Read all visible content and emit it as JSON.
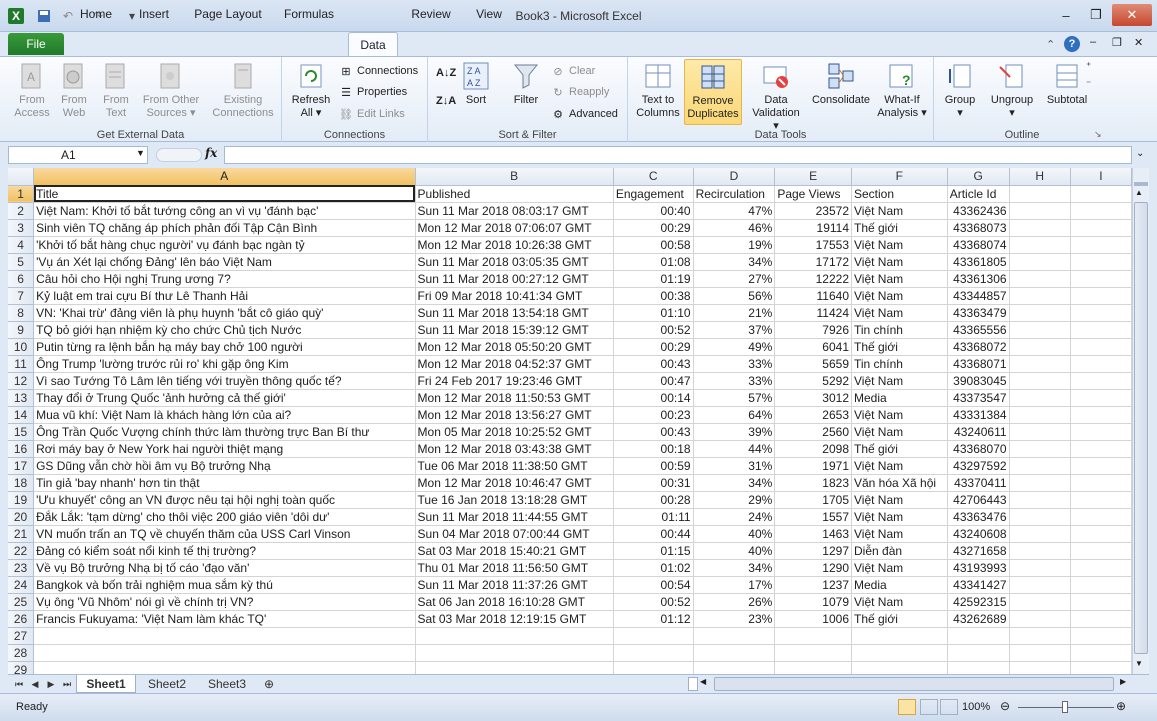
{
  "window": {
    "title": "Book3 - Microsoft Excel"
  },
  "tabs": [
    "File",
    "Home",
    "Insert",
    "Page Layout",
    "Formulas",
    "Data",
    "Review",
    "View"
  ],
  "ribbon": {
    "get_external": {
      "label": "Get External Data",
      "from_access": "From Access",
      "from_web": "From Web",
      "from_text": "From Text",
      "from_other": "From Other Sources",
      "existing": "Existing Connections"
    },
    "connections": {
      "label": "Connections",
      "refresh_all": "Refresh All",
      "connections": "Connections",
      "properties": "Properties",
      "edit_links": "Edit Links"
    },
    "sort_filter": {
      "label": "Sort & Filter",
      "sort": "Sort",
      "filter": "Filter",
      "clear": "Clear",
      "reapply": "Reapply",
      "advanced": "Advanced"
    },
    "data_tools": {
      "label": "Data Tools",
      "text_to_columns": "Text to Columns",
      "remove_duplicates": "Remove Duplicates",
      "data_validation": "Data Validation",
      "consolidate": "Consolidate",
      "what_if": "What-If Analysis"
    },
    "outline": {
      "label": "Outline",
      "group": "Group",
      "ungroup": "Ungroup",
      "subtotal": "Subtotal"
    }
  },
  "formula_bar": {
    "name_box": "A1",
    "fx": "fx",
    "formula": ""
  },
  "columns": [
    "A",
    "B",
    "C",
    "D",
    "E",
    "F",
    "G",
    "H",
    "I"
  ],
  "rows": [
    [
      "Title",
      "Published",
      "Engagement",
      "Recirculation",
      "Page Views",
      "Section",
      "Article Id"
    ],
    [
      "Việt Nam: Khởi tố bắt tướng công an vì vụ 'đánh bạc'",
      "Sun 11 Mar 2018 08:03:17 GMT",
      "00:40",
      "47%",
      "23572",
      "Việt Nam",
      "43362436"
    ],
    [
      "Sinh viên TQ chăng áp phích phản đối Tập Cận Bình",
      "Mon 12 Mar 2018 07:06:07 GMT",
      "00:29",
      "46%",
      "19114",
      "Thế giới",
      "43368073"
    ],
    [
      "'Khởi tố bắt hàng chục người' vụ đánh bạc ngàn tỷ",
      "Mon 12 Mar 2018 10:26:38 GMT",
      "00:58",
      "19%",
      "17553",
      "Việt Nam",
      "43368074"
    ],
    [
      "'Vụ án Xét lại chống Đảng' lên báo Việt Nam",
      "Sun 11 Mar 2018 03:05:35 GMT",
      "01:08",
      "34%",
      "17172",
      "Việt Nam",
      "43361805"
    ],
    [
      "Câu hỏi cho Hội nghị Trung ương 7?",
      "Sun 11 Mar 2018 00:27:12 GMT",
      "01:19",
      "27%",
      "12222",
      "Việt Nam",
      "43361306"
    ],
    [
      "Kỷ luật em trai cựu Bí thư Lê Thanh Hải",
      "Fri 09 Mar 2018 10:41:34 GMT",
      "00:38",
      "56%",
      "11640",
      "Việt Nam",
      "43344857"
    ],
    [
      "VN: 'Khai trừ' đảng viên là phụ huynh 'bắt cô giáo quỳ'",
      "Sun 11 Mar 2018 13:54:18 GMT",
      "01:10",
      "21%",
      "11424",
      "Việt Nam",
      "43363479"
    ],
    [
      "TQ bỏ giới hạn nhiệm kỳ cho chức Chủ tịch Nước",
      "Sun 11 Mar 2018 15:39:12 GMT",
      "00:52",
      "37%",
      "7926",
      "Tin chính",
      "43365556"
    ],
    [
      "Putin từng ra lệnh bắn hạ máy bay chở 100 người",
      "Mon 12 Mar 2018 05:50:20 GMT",
      "00:29",
      "49%",
      "6041",
      "Thế giới",
      "43368072"
    ],
    [
      "Ông Trump 'lường trước rủi ro' khi gặp ông Kim",
      "Mon 12 Mar 2018 04:52:37 GMT",
      "00:43",
      "33%",
      "5659",
      "Tin chính",
      "43368071"
    ],
    [
      "Vì sao Tướng Tô Lâm lên tiếng với truyền thông quốc tế?",
      "Fri 24 Feb 2017 19:23:46 GMT",
      "00:47",
      "33%",
      "5292",
      "Việt Nam",
      "39083045"
    ],
    [
      "Thay đổi ở Trung Quốc 'ảnh hưởng cả thế giới'",
      "Mon 12 Mar 2018 11:50:53 GMT",
      "00:14",
      "57%",
      "3012",
      "Media",
      "43373547"
    ],
    [
      "Mua vũ khí: Việt Nam là khách hàng lớn của ai?",
      "Mon 12 Mar 2018 13:56:27 GMT",
      "00:23",
      "64%",
      "2653",
      "Việt Nam",
      "43331384"
    ],
    [
      "Ông Trần Quốc Vượng chính thức làm thường trực Ban Bí thư",
      "Mon 05 Mar 2018 10:25:52 GMT",
      "00:43",
      "39%",
      "2560",
      "Việt Nam",
      "43240611"
    ],
    [
      "Rơi máy bay ở New York hai người thiệt mạng",
      "Mon 12 Mar 2018 03:43:38 GMT",
      "00:18",
      "44%",
      "2098",
      "Thế giới",
      "43368070"
    ],
    [
      "GS Dũng vẫn chờ hồi âm vụ Bộ trưởng Nhạ",
      "Tue 06 Mar 2018 11:38:50 GMT",
      "00:59",
      "31%",
      "1971",
      "Việt Nam",
      "43297592"
    ],
    [
      "Tin giả 'bay nhanh' hơn tin thật",
      "Mon 12 Mar 2018 10:46:47 GMT",
      "00:31",
      "34%",
      "1823",
      "Văn hóa Xã hội",
      "43370411"
    ],
    [
      "'Ưu khuyết' công an VN được nêu tại hội nghị toàn quốc",
      "Tue 16 Jan 2018 13:18:28 GMT",
      "00:28",
      "29%",
      "1705",
      "Việt Nam",
      "42706443"
    ],
    [
      "Đắk Lắk: 'tạm dừng' cho thôi việc 200 giáo viên 'dôi dư'",
      "Sun 11 Mar 2018 11:44:55 GMT",
      "01:11",
      "24%",
      "1557",
      "Việt Nam",
      "43363476"
    ],
    [
      "VN muốn trấn an TQ về chuyến thăm của USS Carl Vinson",
      "Sun 04 Mar 2018 07:00:44 GMT",
      "00:44",
      "40%",
      "1463",
      "Việt Nam",
      "43240608"
    ],
    [
      "Đảng có kiểm soát nổi kinh tế thị trường?",
      "Sat 03 Mar 2018 15:40:21 GMT",
      "01:15",
      "40%",
      "1297",
      "Diễn đàn",
      "43271658"
    ],
    [
      "Về vụ Bộ trưởng Nhạ bị tố cáo 'đạo văn'",
      "Thu 01 Mar 2018 11:56:50 GMT",
      "01:02",
      "34%",
      "1290",
      "Việt Nam",
      "43193993"
    ],
    [
      "Bangkok và bốn trải nghiệm mua sắm kỳ thú",
      "Sun 11 Mar 2018 11:37:26 GMT",
      "00:54",
      "17%",
      "1237",
      "Media",
      "43341427"
    ],
    [
      "Vụ ông 'Vũ Nhôm' nói gì về chính trị VN?",
      "Sat 06 Jan 2018 16:10:28 GMT",
      "00:52",
      "26%",
      "1079",
      "Việt Nam",
      "42592315"
    ],
    [
      "Francis Fukuyama: 'Việt Nam làm khác TQ'",
      "Sat 03 Mar 2018 12:19:15 GMT",
      "01:12",
      "23%",
      "1006",
      "Thế giới",
      "43262689"
    ]
  ],
  "row_numbers": [
    "1",
    "2",
    "3",
    "4",
    "5",
    "6",
    "7",
    "8",
    "9",
    "10",
    "11",
    "12",
    "13",
    "14",
    "15",
    "16",
    "17",
    "18",
    "19",
    "20",
    "21",
    "22",
    "23",
    "24",
    "25",
    "26",
    "27",
    "28",
    "29"
  ],
  "sheets": [
    "Sheet1",
    "Sheet2",
    "Sheet3"
  ],
  "status": {
    "ready": "Ready",
    "zoom": "100%"
  },
  "colors": {
    "accent": "#1f7a2a",
    "selected_header": "#f1c15f",
    "ribbon_border": "#a6bcda"
  }
}
